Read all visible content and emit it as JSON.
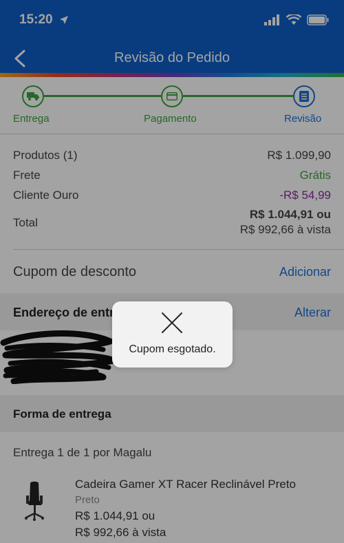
{
  "status_bar": {
    "time": "15:20"
  },
  "header": {
    "title": "Revisão do Pedido"
  },
  "steps": [
    {
      "label": "Entrega"
    },
    {
      "label": "Pagamento"
    },
    {
      "label": "Revisão"
    }
  ],
  "summary": {
    "products_label": "Produtos (1)",
    "products_value": "R$ 1.099,90",
    "shipping_label": "Frete",
    "shipping_value": "Grátis",
    "member_label": "Cliente Ouro",
    "member_value": "-R$ 54,99",
    "total_label": "Total",
    "total_line1": "R$ 1.044,91 ou",
    "total_line2": "R$ 992,66 à vista"
  },
  "coupon": {
    "label": "Cupom de desconto",
    "action": "Adicionar"
  },
  "address": {
    "title": "Endereço de entrega",
    "action": "Alterar"
  },
  "delivery": {
    "title": "Forma de entrega",
    "subtitle": "Entrega 1 de 1 por Magalu"
  },
  "product": {
    "name": "Cadeira Gamer XT Racer Reclinável Preto",
    "variant": "Preto",
    "price_line1": "R$ 1.044,91 ou",
    "price_line2": "R$ 992,66 à vista"
  },
  "toast": {
    "message": "Cupom esgotado."
  },
  "colors": {
    "header": "#0f5ec7",
    "step_done": "#3aa33a",
    "step_current": "#1f6fd6",
    "free": "#3aa33a",
    "discount": "#8c2aa0",
    "link": "#1f6fd6"
  }
}
